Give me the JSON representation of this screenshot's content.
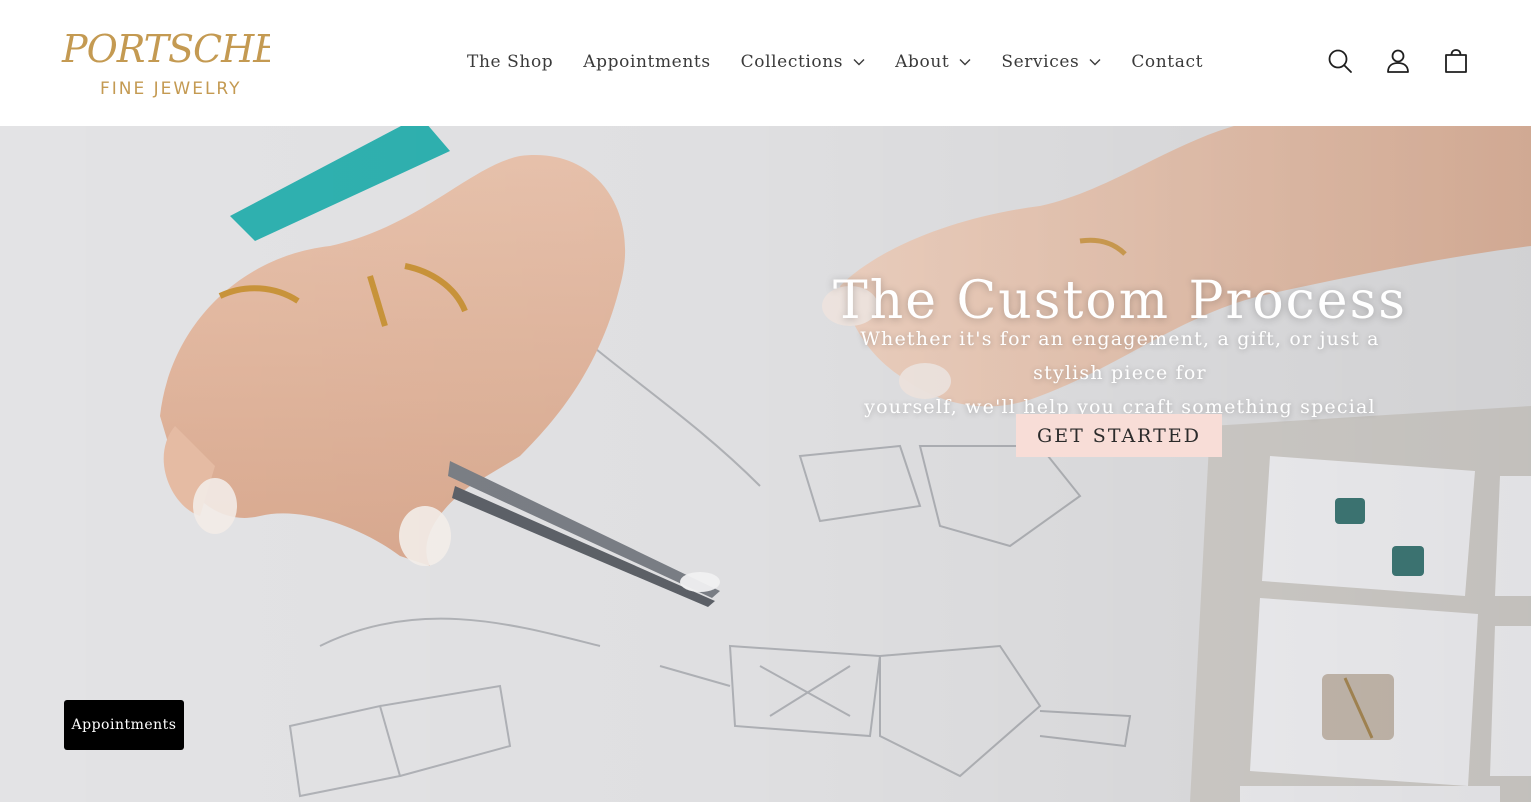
{
  "brand": {
    "logo_main": "PORTSCHE'S",
    "logo_sub": "FINE JEWELRY",
    "colors": {
      "gold": "#c49a52",
      "button_pink": "#f8ddd7",
      "black": "#000000"
    }
  },
  "nav": {
    "items": [
      {
        "label": "The Shop",
        "has_dropdown": false
      },
      {
        "label": "Appointments",
        "has_dropdown": false
      },
      {
        "label": "Collections",
        "has_dropdown": true
      },
      {
        "label": "About",
        "has_dropdown": true
      },
      {
        "label": "Services",
        "has_dropdown": true
      },
      {
        "label": "Contact",
        "has_dropdown": false
      }
    ]
  },
  "header_icons": [
    "search-icon",
    "account-icon",
    "cart-icon"
  ],
  "hero": {
    "title": "The Custom Process",
    "subtitle_line1": "Whether it's for an engagement, a gift, or just a stylish piece for",
    "subtitle_line2": "yourself, we'll help you craft something special",
    "cta_label": "GET STARTED"
  },
  "floating": {
    "appointments_label": "Appointments"
  }
}
